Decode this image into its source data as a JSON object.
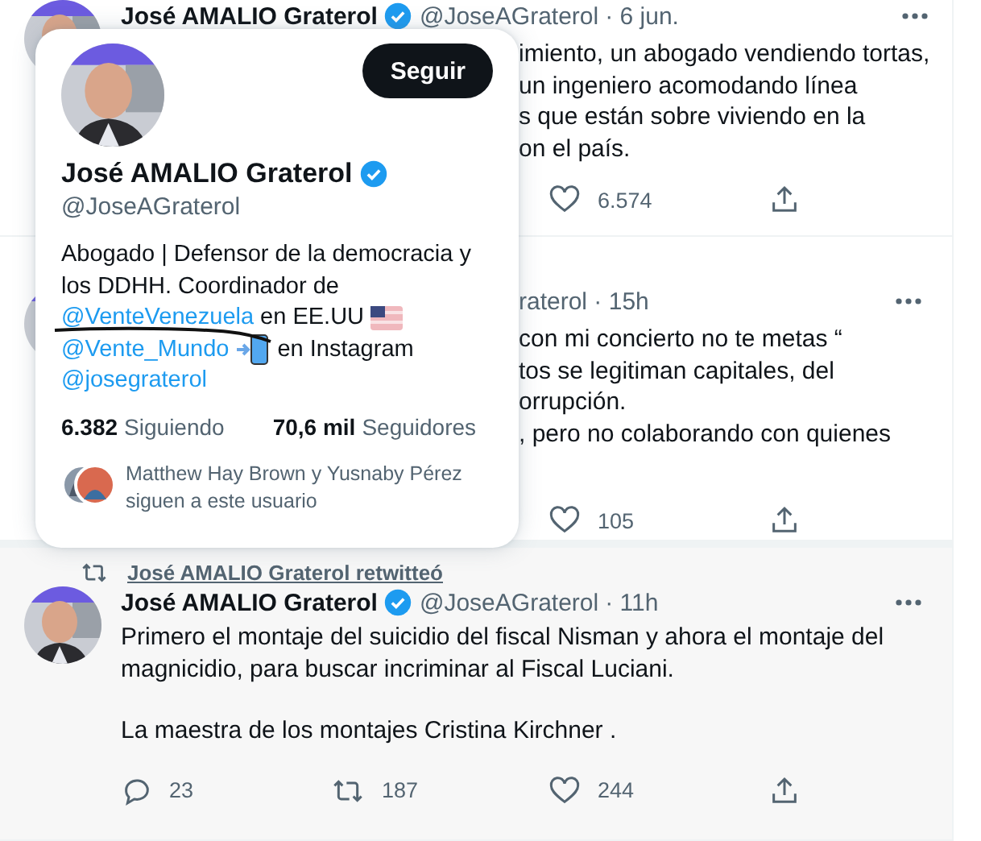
{
  "tweets": [
    {
      "header": {
        "name": "José AMALIO Graterol",
        "verified": true,
        "handle": "@JoseAGraterol",
        "time": "· 6 jun."
      },
      "body_visible_lines": [
        "imiento, un abogado vendiendo tortas,",
        "un ingeniero acomodando línea",
        "s que están sobre viviendo en la",
        "on el país."
      ],
      "actions": [
        {
          "kind": "like",
          "count": "6.574"
        },
        {
          "kind": "share"
        }
      ]
    },
    {
      "header_visible": "raterol · 15h",
      "body_visible_lines": [
        "con mi concierto no te metas “",
        "tos se legitiman capitales, del",
        "orrupción.",
        ", pero no colaborando con quienes"
      ],
      "actions": [
        {
          "kind": "like",
          "count": "105"
        },
        {
          "kind": "share"
        }
      ]
    },
    {
      "retweeted_by": "José AMALIO Graterol retwitteó",
      "header": {
        "name": "José AMALIO Graterol",
        "verified": true,
        "handle": "@JoseAGraterol",
        "time": "· 11h"
      },
      "body_paragraphs": [
        "Primero el montaje del suicidio del fiscal Nisman y ahora el montaje del magnicidio, para buscar incriminar al Fiscal Luciani.",
        "La maestra de los montajes Cristina Kirchner ."
      ],
      "actions": [
        {
          "kind": "reply",
          "count": "23"
        },
        {
          "kind": "retweet",
          "count": "187"
        },
        {
          "kind": "like",
          "count": "244"
        },
        {
          "kind": "share"
        }
      ]
    }
  ],
  "hover_card": {
    "follow_button": "Seguir",
    "name": "José AMALIO Graterol",
    "verified": true,
    "handle": "@JoseAGraterol",
    "bio_lines": [
      [
        {
          "kind": "text",
          "text": "Abogado | Defensor de la democracia y"
        }
      ],
      [
        {
          "kind": "text",
          "text": "los DDHH. Coordinador de"
        }
      ],
      [
        {
          "kind": "link",
          "text": "@VenteVenezuela"
        },
        {
          "kind": "text",
          "text": "en EE.UU"
        },
        {
          "kind": "flag"
        }
      ],
      [
        {
          "kind": "link",
          "text": "@Vente_Mundo"
        },
        {
          "kind": "phone"
        },
        {
          "kind": "text",
          "text": "en Instagram"
        }
      ],
      [
        {
          "kind": "link",
          "text": "@josegraterol"
        }
      ]
    ],
    "stats": [
      {
        "value": "6.382",
        "label": "Siguiendo"
      },
      {
        "value": "70,6 mil",
        "label": "Seguidores"
      }
    ],
    "followed_by": "Matthew Hay Brown y Yusnaby Pérez siguen a este usuario"
  }
}
